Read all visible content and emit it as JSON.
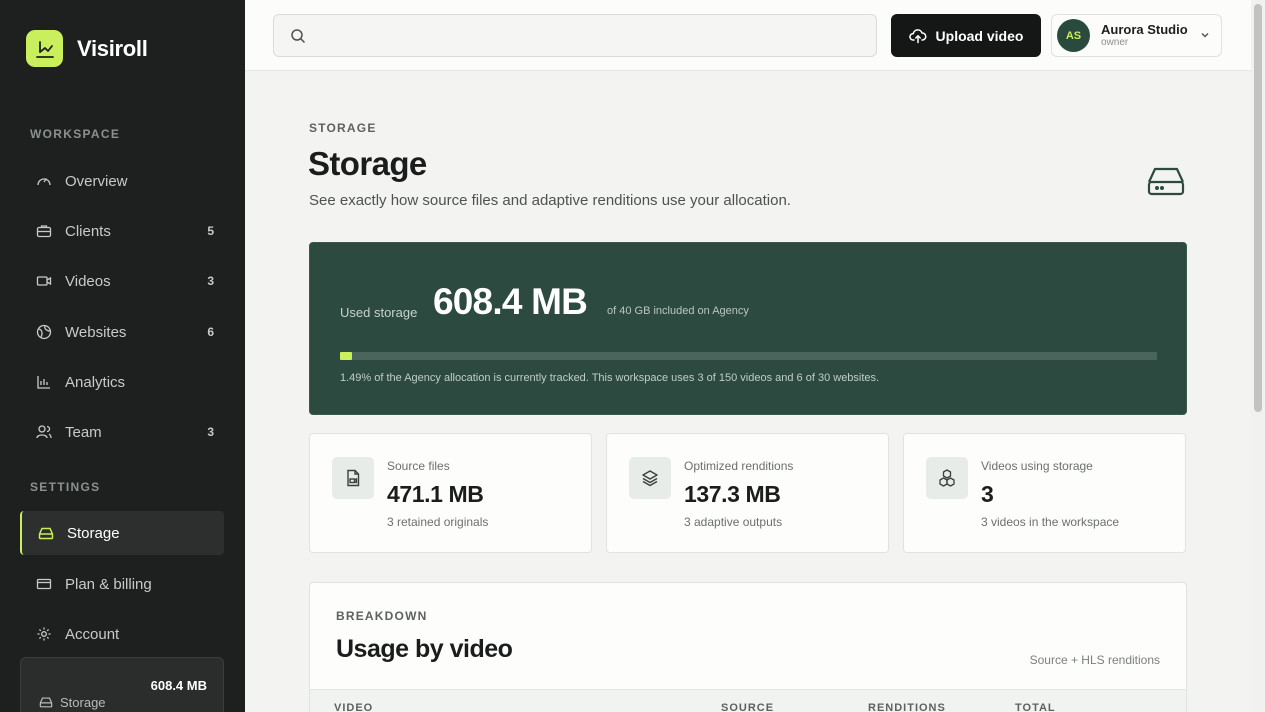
{
  "brand": {
    "name": "Visiroll",
    "accent": "#c9ef5c"
  },
  "sidebar": {
    "workspace_label": "WORKSPACE",
    "settings_label": "SETTINGS",
    "items": [
      {
        "label": "Overview",
        "count": "",
        "icon": "gauge-icon"
      },
      {
        "label": "Clients",
        "count": "5",
        "icon": "briefcase-icon"
      },
      {
        "label": "Videos",
        "count": "3",
        "icon": "video-icon"
      },
      {
        "label": "Websites",
        "count": "6",
        "icon": "globe-icon"
      },
      {
        "label": "Analytics",
        "count": "",
        "icon": "bar-chart-icon"
      },
      {
        "label": "Team",
        "count": "3",
        "icon": "users-icon"
      }
    ],
    "settings": [
      {
        "label": "Storage",
        "icon": "drive-icon",
        "active": true
      },
      {
        "label": "Plan & billing",
        "icon": "credit-card-icon"
      },
      {
        "label": "Account",
        "icon": "gear-icon"
      }
    ],
    "storage_mini": {
      "label": "Storage",
      "value": "608.4 MB"
    }
  },
  "topbar": {
    "search_placeholder": "",
    "upload_label": "Upload video",
    "user": {
      "initials": "AS",
      "name": "Aurora Studio",
      "role": "owner"
    }
  },
  "page": {
    "eyebrow": "STORAGE",
    "title": "Storage",
    "subtitle": "See exactly how source files and adaptive renditions use your allocation."
  },
  "hero": {
    "label": "Used storage",
    "value": "608.4 MB",
    "of": "of 40 GB included on Agency",
    "progress_percent": 1.49,
    "note": "1.49% of the Agency allocation is currently tracked. This workspace uses 3 of 150 videos and 6 of 30 websites."
  },
  "stats": [
    {
      "title": "Source files",
      "value": "471.1 MB",
      "sub": "3 retained originals",
      "icon": "file-icon"
    },
    {
      "title": "Optimized renditions",
      "value": "137.3 MB",
      "sub": "3 adaptive outputs",
      "icon": "layers-icon"
    },
    {
      "title": "Videos using storage",
      "value": "3",
      "sub": "3 videos in the workspace",
      "icon": "cubes-icon"
    }
  ],
  "breakdown": {
    "eyebrow": "BREAKDOWN",
    "title": "Usage by video",
    "hint": "Source + HLS renditions",
    "columns": [
      "VIDEO",
      "SOURCE",
      "RENDITIONS",
      "TOTAL"
    ]
  }
}
